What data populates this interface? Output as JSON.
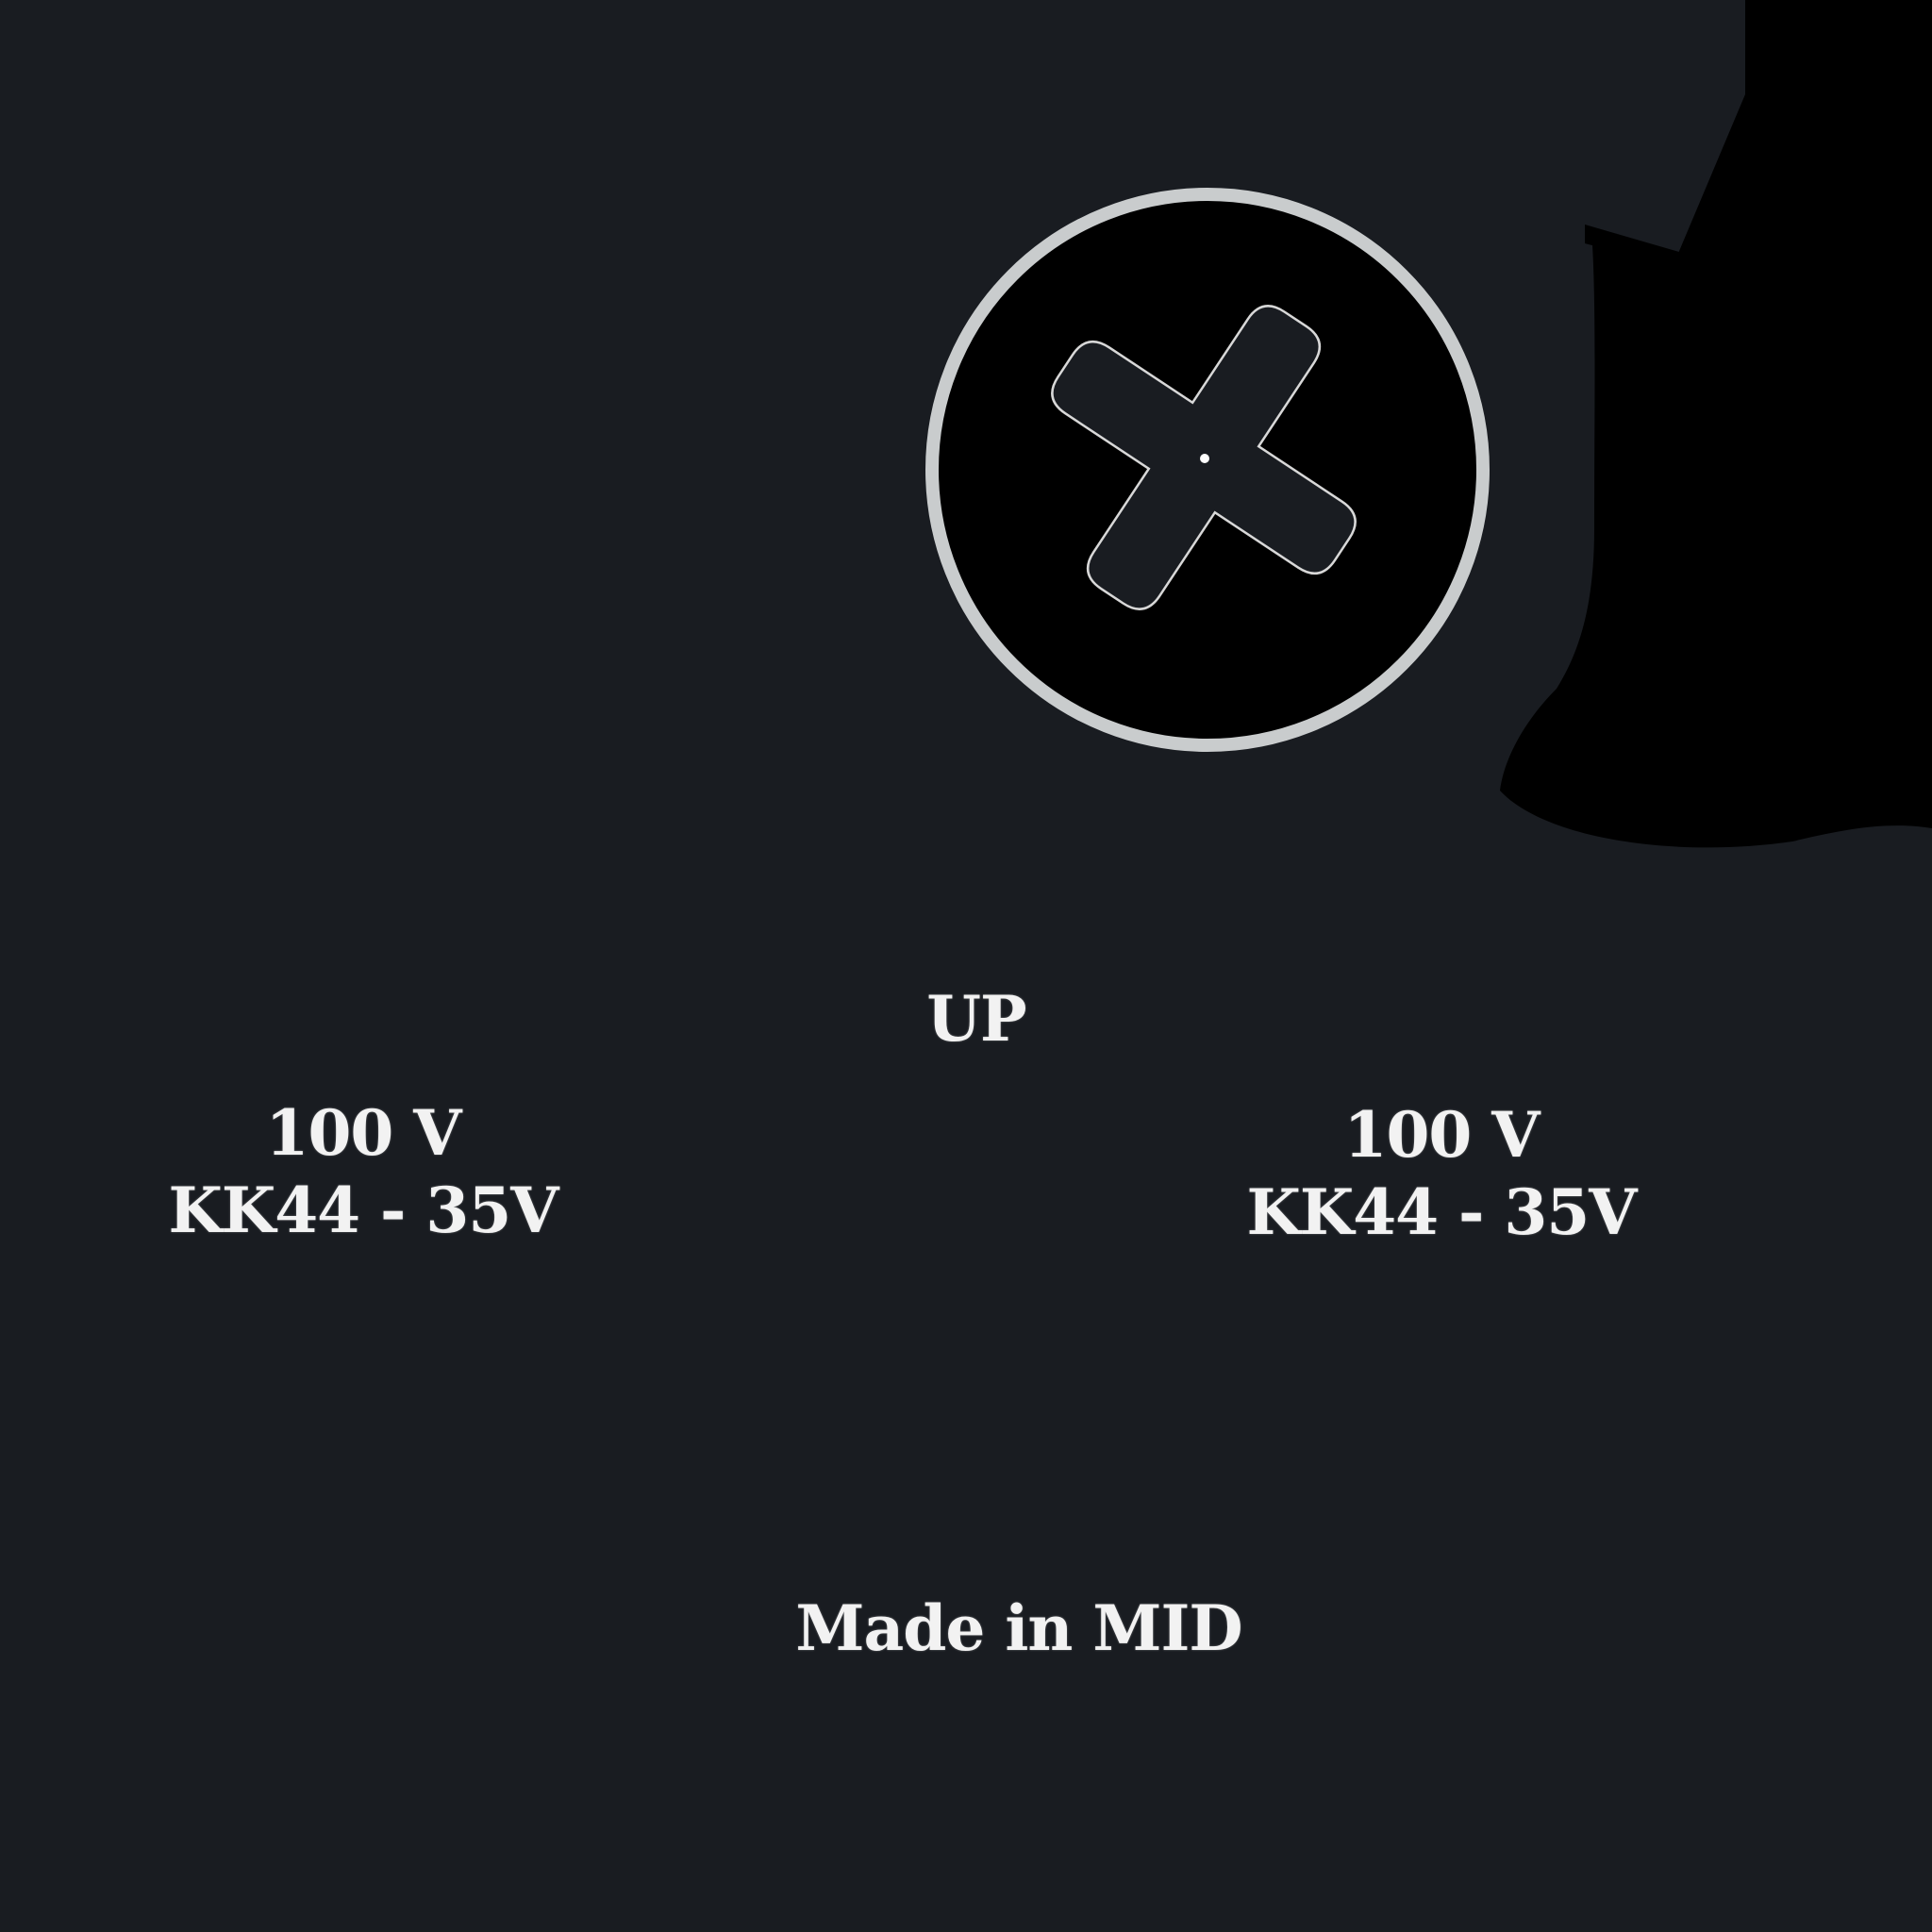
{
  "colors": {
    "background": "#191c21",
    "dark_shape": "#000000",
    "ring": "#c9cccd",
    "text": "#f2f2f2"
  },
  "icons": {
    "screw": "phillips-screw-icon"
  },
  "up_label": "UP",
  "left_spec": {
    "voltage": "100 V",
    "model": "KK44 - 35V"
  },
  "right_spec": {
    "voltage": "100 V",
    "model": "KK44 - 35V"
  },
  "made_in": "Made in MID"
}
